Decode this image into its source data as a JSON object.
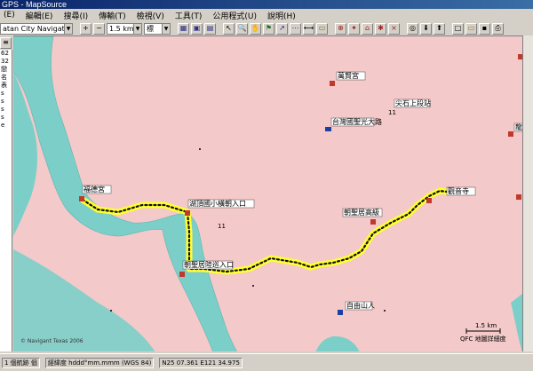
{
  "window": {
    "title": "GPS - MapSource"
  },
  "menu": [
    {
      "label": "(E)"
    },
    {
      "label": "編輯(E)"
    },
    {
      "label": "搜尋(I)"
    },
    {
      "label": "傳輸(T)"
    },
    {
      "label": "檢視(V)"
    },
    {
      "label": "工具(T)"
    },
    {
      "label": "公用程式(U)"
    },
    {
      "label": "說明(H)"
    }
  ],
  "toolbar": {
    "map_product": "atan City Navigator v8.60",
    "zoom_scale": "1.5 km",
    "detail_level": "標"
  },
  "left_panel": {
    "rows": [
      "62",
      "32",
      "戀",
      "名",
      "表",
      "s",
      "s",
      "s",
      "s",
      "e"
    ]
  },
  "map": {
    "pois": [
      {
        "label": "福德宮",
        "id": "poi1"
      },
      {
        "label": "湖頂國小橫朝入口",
        "id": "poi2"
      },
      {
        "label": "朝聖居陸巡入口",
        "id": "poi3"
      },
      {
        "label": "朝聖居高級",
        "id": "poi4"
      },
      {
        "label": "觀音寺",
        "id": "poi5"
      },
      {
        "label": "萬賢宮",
        "id": "poi6"
      },
      {
        "label": "尖石上段站",
        "id": "poi7"
      },
      {
        "label": "台灣國聖光大路",
        "id": "poi8"
      },
      {
        "label": "自由山人",
        "id": "poi9"
      },
      {
        "label": "龍興宮",
        "id": "poi10"
      }
    ],
    "scale_label": "1.5 km",
    "copyright": "© Navigant Texas 2006",
    "corner_label": "QFC 地圖詳細度"
  },
  "status": {
    "coord_label": "經緯度 hddd°mm.mmm (WGS 84)",
    "coord_value": "N25 07.361 E121 34.975",
    "left_label": "1 個航跡 個"
  }
}
